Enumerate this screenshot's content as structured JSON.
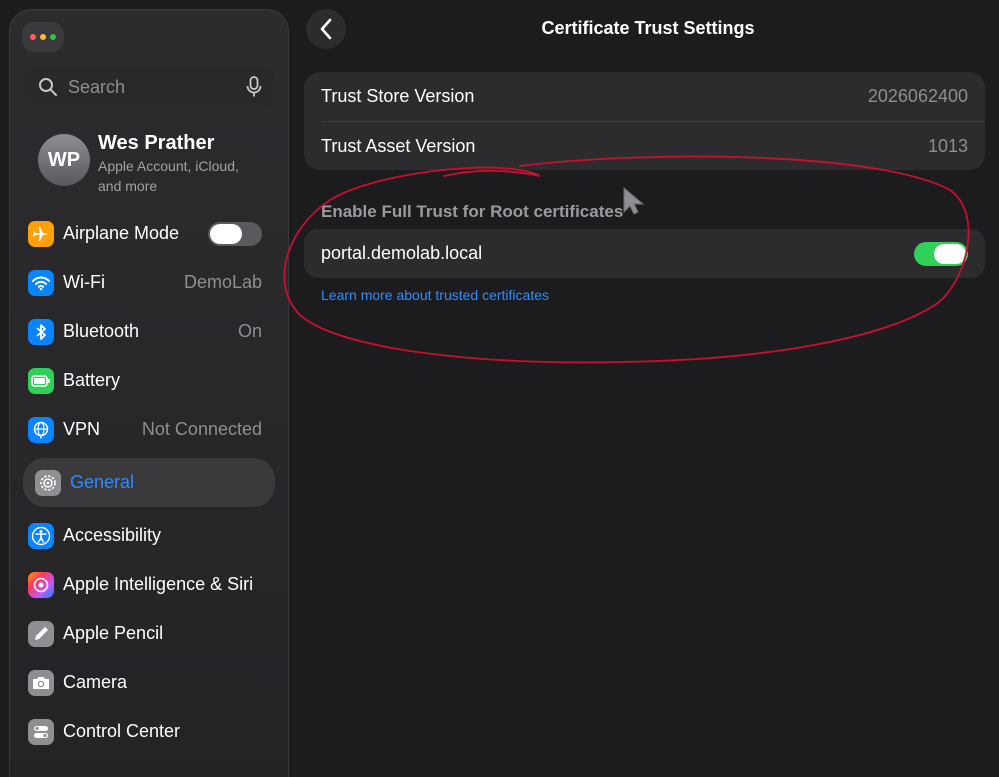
{
  "sidebar": {
    "search_placeholder": "Search",
    "profile": {
      "initials": "WP",
      "name": "Wes Prather",
      "subtitle": "Apple Account, iCloud, and more"
    },
    "items": [
      {
        "label": "Airplane Mode",
        "icon": "airplane-icon",
        "color": "#ff9f0a",
        "toggle": "off"
      },
      {
        "label": "Wi-Fi",
        "value": "DemoLab",
        "icon": "wifi-icon",
        "color": "#0a84ff"
      },
      {
        "label": "Bluetooth",
        "value": "On",
        "icon": "bluetooth-icon",
        "color": "#0a84ff"
      },
      {
        "label": "Battery",
        "icon": "battery-icon",
        "color": "#30d158"
      },
      {
        "label": "VPN",
        "value": "Not Connected",
        "icon": "vpn-icon",
        "color": "#0a84ff"
      },
      {
        "label": "General",
        "icon": "gear-icon",
        "color": "#8e8e93",
        "selected": true
      },
      {
        "label": "Accessibility",
        "icon": "accessibility-icon",
        "color": "#0a84ff"
      },
      {
        "label": "Apple Intelligence & Siri",
        "icon": "siri-icon",
        "color": "#bf5af2"
      },
      {
        "label": "Apple Pencil",
        "icon": "pencil-icon",
        "color": "#8e8e93"
      },
      {
        "label": "Camera",
        "icon": "camera-icon",
        "color": "#8e8e93"
      },
      {
        "label": "Control Center",
        "icon": "control-center-icon",
        "color": "#8e8e93"
      }
    ]
  },
  "header": {
    "title": "Certificate Trust Settings"
  },
  "trust_info": {
    "rows": [
      {
        "label": "Trust Store Version",
        "value": "2026062400"
      },
      {
        "label": "Trust Asset Version",
        "value": "1013"
      }
    ]
  },
  "full_trust": {
    "header": "Enable Full Trust for Root certificates",
    "certificate": "portal.demolab.local",
    "enabled": true,
    "learn_more": "Learn more about trusted certificates"
  },
  "colors": {
    "accent": "#2f8cff",
    "toggle_on": "#30d158",
    "annotation": "#c8102e"
  }
}
